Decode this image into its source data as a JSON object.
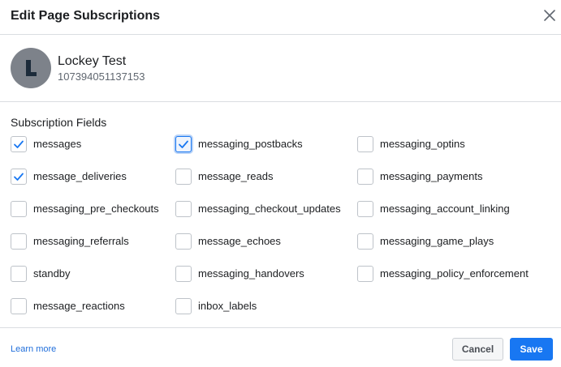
{
  "dialog": {
    "title": "Edit Page Subscriptions",
    "close_icon": "close-icon"
  },
  "page": {
    "avatar_letter": "L",
    "name": "Lockey Test",
    "id": "107394051137153"
  },
  "subscriptions": {
    "label": "Subscription Fields",
    "fields": [
      {
        "label": "messages",
        "checked": true
      },
      {
        "label": "messaging_postbacks",
        "checked": true
      },
      {
        "label": "messaging_optins",
        "checked": false
      },
      {
        "label": "message_deliveries",
        "checked": true
      },
      {
        "label": "message_reads",
        "checked": false
      },
      {
        "label": "messaging_payments",
        "checked": false
      },
      {
        "label": "messaging_pre_checkouts",
        "checked": false
      },
      {
        "label": "messaging_checkout_updates",
        "checked": false
      },
      {
        "label": "messaging_account_linking",
        "checked": false
      },
      {
        "label": "messaging_referrals",
        "checked": false
      },
      {
        "label": "message_echoes",
        "checked": false
      },
      {
        "label": "messaging_game_plays",
        "checked": false
      },
      {
        "label": "standby",
        "checked": false
      },
      {
        "label": "messaging_handovers",
        "checked": false
      },
      {
        "label": "messaging_policy_enforcement",
        "checked": false
      },
      {
        "label": "message_reactions",
        "checked": false
      },
      {
        "label": "inbox_labels",
        "checked": false
      }
    ]
  },
  "footer": {
    "learn_more": "Learn more",
    "cancel_label": "Cancel",
    "save_label": "Save"
  },
  "colors": {
    "primary": "#1877f2",
    "check": "#1877f2",
    "avatar_bg": "#7d828a",
    "avatar_letter": "#1c2b3a"
  }
}
